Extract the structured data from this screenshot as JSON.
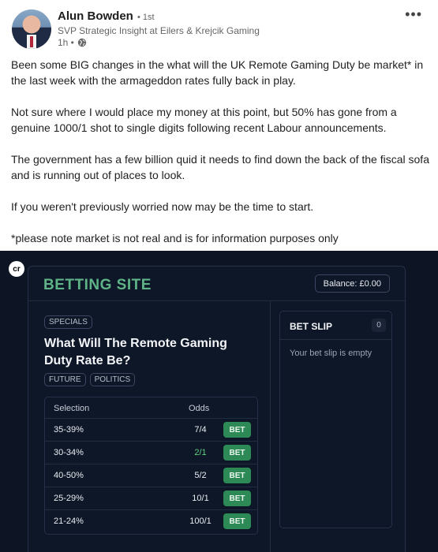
{
  "post": {
    "author": "Alun Bowden",
    "degree": "• 1st",
    "headline": "SVP Strategic Insight at Eilers & Krejcik Gaming",
    "time": "1h •",
    "paragraphs": [
      "Been some BIG changes in the what will the UK Remote Gaming Duty be market* in the last week with the armageddon rates fully back in play.",
      "Not sure where I would place my money at this point, but 50% has gone from a genuine 1000/1 shot to single digits following recent Labour announcements.",
      "The government has a few billion quid it needs to find down the back of the fiscal sofa and is running out of places to look.",
      "If you weren't previously worried now may be the time to start.",
      "*please note market is not real and is for information purposes only"
    ],
    "more_label": "•••"
  },
  "image": {
    "logo_text": "cr",
    "site_title": "BETTING SITE",
    "balance": "Balance: £0.00",
    "category_tag": "SPECIALS",
    "market_title": "What Will The Remote Gaming Duty Rate Be?",
    "tags": [
      "FUTURE",
      "POLITICS"
    ],
    "table": {
      "headers": {
        "selection": "Selection",
        "odds": "Odds"
      },
      "rows": [
        {
          "selection": "35-39%",
          "odds": "7/4",
          "bet": "BET",
          "highlight": false
        },
        {
          "selection": "30-34%",
          "odds": "2/1",
          "bet": "BET",
          "highlight": true
        },
        {
          "selection": "40-50%",
          "odds": "5/2",
          "bet": "BET",
          "highlight": false
        },
        {
          "selection": "25-29%",
          "odds": "10/1",
          "bet": "BET",
          "highlight": false
        },
        {
          "selection": "21-24%",
          "odds": "100/1",
          "bet": "BET",
          "highlight": false
        }
      ]
    },
    "bet_slip": {
      "title": "BET SLIP",
      "count": "0",
      "empty_text": "Your bet slip is empty"
    }
  },
  "colors": {
    "accent_green": "#5fb487",
    "bet_button": "#2d8a56",
    "odds_highlight": "#5fcf7e",
    "image_background": "#0d1524"
  },
  "icons": [
    "globe-icon",
    "more-options-icon",
    "cr-logo-icon"
  ]
}
